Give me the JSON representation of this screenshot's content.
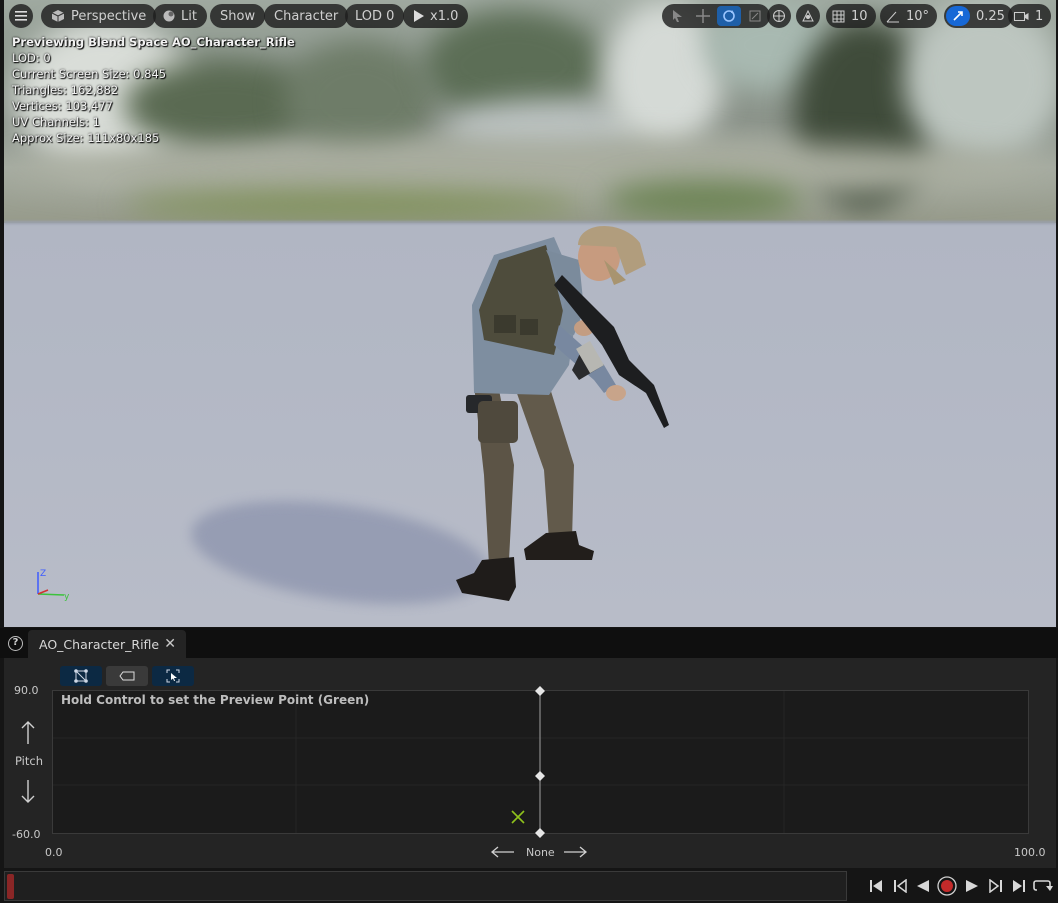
{
  "toolbar": {
    "menu_icon": "hamburger-icon",
    "perspective_label": "Perspective",
    "lit_label": "Lit",
    "show_label": "Show",
    "character_label": "Character",
    "lod_label": "LOD 0",
    "play_speed_label": "x1.0",
    "grid_snap_value": "10",
    "rotation_snap_value": "10°",
    "scale_snap_value": "0.25",
    "camera_speed_value": "1"
  },
  "stats": {
    "title": "Previewing Blend Space AO_Character_Rifle",
    "lod": "LOD: 0",
    "screen_size": "Current Screen Size: 0.845",
    "triangles": "Triangles: 162,882",
    "vertices": "Vertices: 103,477",
    "uv_channels": "UV Channels: 1",
    "approx_size": "Approx Size: 111x80x185"
  },
  "axes": {
    "z": "Z",
    "y": "y"
  },
  "tab": {
    "help": "?",
    "label": "AO_Character_Rifle",
    "close": "✕"
  },
  "blend_space": {
    "hint": "Hold Control to set the Preview Point (Green)",
    "y_max": "90.0",
    "y_min": "-60.0",
    "y_name": "Pitch",
    "x_min": "0.0",
    "x_max": "100.0",
    "x_name": "None",
    "accent_green": "#8fc21c"
  },
  "transport": {
    "icons": [
      "skip-to-start-icon",
      "step-back-icon",
      "play-reverse-icon",
      "record-icon",
      "play-icon",
      "step-forward-icon",
      "skip-to-end-icon",
      "loop-icon"
    ],
    "record_color": "#c42a2a"
  }
}
